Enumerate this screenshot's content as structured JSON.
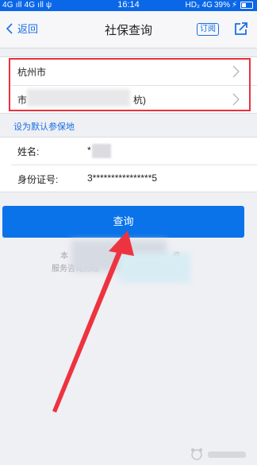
{
  "status": {
    "carrier": "4G ıll 4G ıll ψ",
    "time": "16:14",
    "network": "HD₂ 4G",
    "battery_percent": "39%",
    "battery_level": 0.39,
    "charging": "⚡"
  },
  "nav": {
    "back_label": "返回",
    "title": "社保查询",
    "subscribe_label": "订阅"
  },
  "region": {
    "city": "杭州市",
    "org_prefix": "市",
    "org_suffix": "杭)"
  },
  "set_default_link": "设为默认参保地",
  "form": {
    "name_label": "姓名:",
    "name_value": "*",
    "id_label": "身份证号:",
    "id_value": "3****************5"
  },
  "query_button": "查询",
  "note": {
    "line1_start": "本",
    "line1_end": "件",
    "line2": "服务咨询热线"
  }
}
